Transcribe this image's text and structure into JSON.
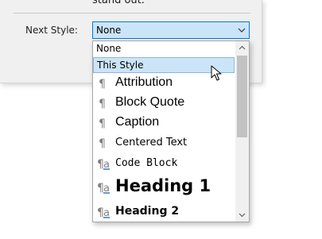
{
  "dialog": {
    "description_tail": "stand out.",
    "next_style_label": "Next Style:",
    "next_style_value": "None"
  },
  "dropdown": {
    "items": [
      {
        "label": "None",
        "kind": "plain"
      },
      {
        "label": "This Style",
        "kind": "plain",
        "selected": true
      },
      {
        "label": "Attribution",
        "kind": "paragraph"
      },
      {
        "label": "Block Quote",
        "kind": "paragraph"
      },
      {
        "label": "Caption",
        "kind": "paragraph"
      },
      {
        "label": "Centered Text",
        "kind": "paragraph"
      },
      {
        "label": "Code Block",
        "kind": "linked"
      },
      {
        "label": "Heading 1",
        "kind": "linked"
      },
      {
        "label": "Heading 2",
        "kind": "linked"
      }
    ]
  },
  "colors": {
    "accent_border": "#0078d7",
    "selection_fill": "#cce4f7",
    "icon_gray": "#808080",
    "icon_blue": "#2e7bc6"
  }
}
